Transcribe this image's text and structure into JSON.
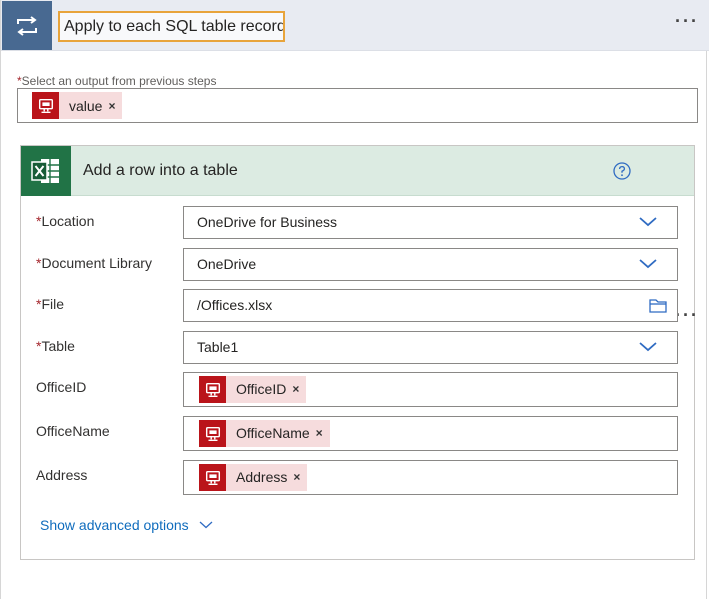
{
  "loop": {
    "title": "Apply to each SQL table record",
    "loop_icon": "loop-arrows-icon",
    "more_icon": "more-dots-icon"
  },
  "select_output": {
    "required_mark": "*",
    "label": "Select an output from previous steps",
    "token": {
      "label": "value",
      "icon": "sql-server-icon",
      "remove": "×"
    }
  },
  "action": {
    "title": "Add a row into a table",
    "connector_icon": "excel-icon",
    "help_icon": "help-icon",
    "more_icon": "more-dots-icon",
    "fields": {
      "location": {
        "required_mark": "*",
        "label": "Location",
        "value": "OneDrive for Business"
      },
      "document_library": {
        "required_mark": "*",
        "label": "Document Library",
        "value": "OneDrive"
      },
      "file": {
        "required_mark": "*",
        "label": "File",
        "value": "/Offices.xlsx"
      },
      "table": {
        "required_mark": "*",
        "label": "Table",
        "value": "Table1"
      },
      "office_id": {
        "label": "OfficeID",
        "token": {
          "label": "OfficeID",
          "remove": "×"
        }
      },
      "office_name": {
        "label": "OfficeName",
        "token": {
          "label": "OfficeName",
          "remove": "×"
        }
      },
      "address": {
        "label": "Address",
        "token": {
          "label": "Address",
          "remove": "×"
        }
      }
    },
    "advanced_label": "Show advanced options"
  },
  "colors": {
    "header_bg": "#e8ebf2",
    "loop_icon_bg": "#486991",
    "title_border": "#e8a43b",
    "excel_green": "#217346",
    "card_header_bg": "#dcebe2",
    "sql_red": "#ba141a",
    "token_bg": "#f6dcdd",
    "link_blue": "#0f6cbd",
    "required_red": "#a4262c"
  }
}
